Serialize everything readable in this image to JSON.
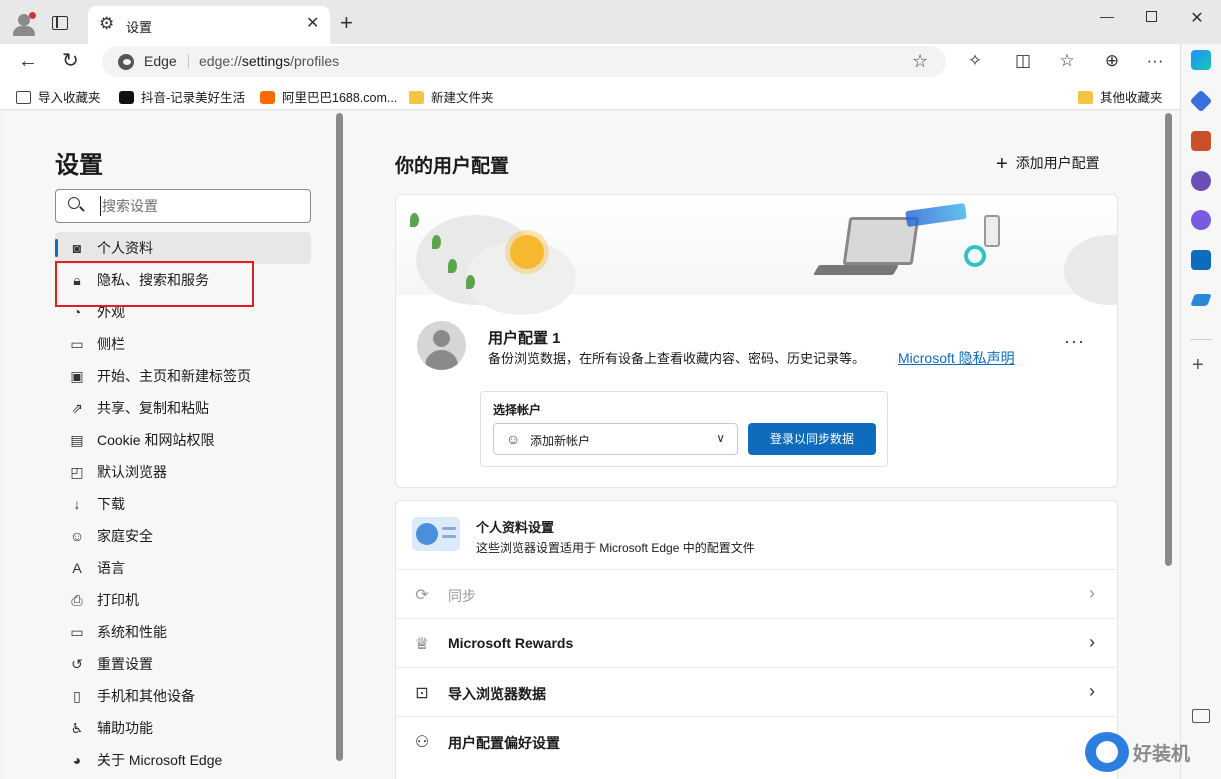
{
  "browser": {
    "tab_title": "设置",
    "address_label": "Edge",
    "url_prefix": "edge://",
    "url_main": "settings",
    "url_rest": "/profiles"
  },
  "favorites": [
    {
      "label": "导入收藏夹",
      "icon": "import-icon"
    },
    {
      "label": "抖音-记录美好生活",
      "icon": "douyin-icon"
    },
    {
      "label": "阿里巴巴1688.com...",
      "icon": "alibaba-icon"
    },
    {
      "label": "新建文件夹",
      "icon": "folder-icon"
    }
  ],
  "other_favorites": "其他收藏夹",
  "nav": {
    "title": "设置",
    "search_placeholder": "搜索设置",
    "items": [
      {
        "label": "个人资料",
        "icon": "person-icon"
      },
      {
        "label": "隐私、搜索和服务",
        "icon": "lock-icon"
      },
      {
        "label": "外观",
        "icon": "palette-icon"
      },
      {
        "label": "侧栏",
        "icon": "sidebar-icon"
      },
      {
        "label": "开始、主页和新建标签页",
        "icon": "home-icon"
      },
      {
        "label": "共享、复制和粘贴",
        "icon": "share-icon"
      },
      {
        "label": "Cookie 和网站权限",
        "icon": "cookie-icon"
      },
      {
        "label": "默认浏览器",
        "icon": "browser-icon"
      },
      {
        "label": "下载",
        "icon": "download-icon"
      },
      {
        "label": "家庭安全",
        "icon": "family-icon"
      },
      {
        "label": "语言",
        "icon": "language-icon"
      },
      {
        "label": "打印机",
        "icon": "printer-icon"
      },
      {
        "label": "系统和性能",
        "icon": "system-icon"
      },
      {
        "label": "重置设置",
        "icon": "reset-icon"
      },
      {
        "label": "手机和其他设备",
        "icon": "phone-icon"
      },
      {
        "label": "辅助功能",
        "icon": "accessibility-icon"
      },
      {
        "label": "关于 Microsoft Edge",
        "icon": "edge-icon"
      }
    ]
  },
  "main": {
    "title": "你的用户配置",
    "add_profile": "添加用户配置",
    "profile": {
      "name": "用户配置 1",
      "description": "备份浏览数据，在所有设备上查看收藏内容、密码、历史记录等。",
      "privacy_link": "Microsoft 隐私声明",
      "more": "···",
      "account_label": "选择帐户",
      "account_value": "添加新帐户",
      "signin_button": "登录以同步数据"
    },
    "personal_settings": {
      "title": "个人资料设置",
      "description": "这些浏览器设置适用于 Microsoft Edge 中的配置文件"
    },
    "rows": [
      {
        "label": "同步",
        "icon": "sync-icon",
        "disabled": true
      },
      {
        "label": "Microsoft Rewards",
        "icon": "trophy-icon",
        "disabled": false
      },
      {
        "label": "导入浏览器数据",
        "icon": "import-data-icon",
        "disabled": false
      },
      {
        "label": "用户配置偏好设置",
        "icon": "profile-prefs-icon",
        "disabled": false
      }
    ]
  },
  "watermark": "好装机",
  "colors": {
    "accent": "#0f6cbd",
    "highlight_box": "#e0201e"
  }
}
